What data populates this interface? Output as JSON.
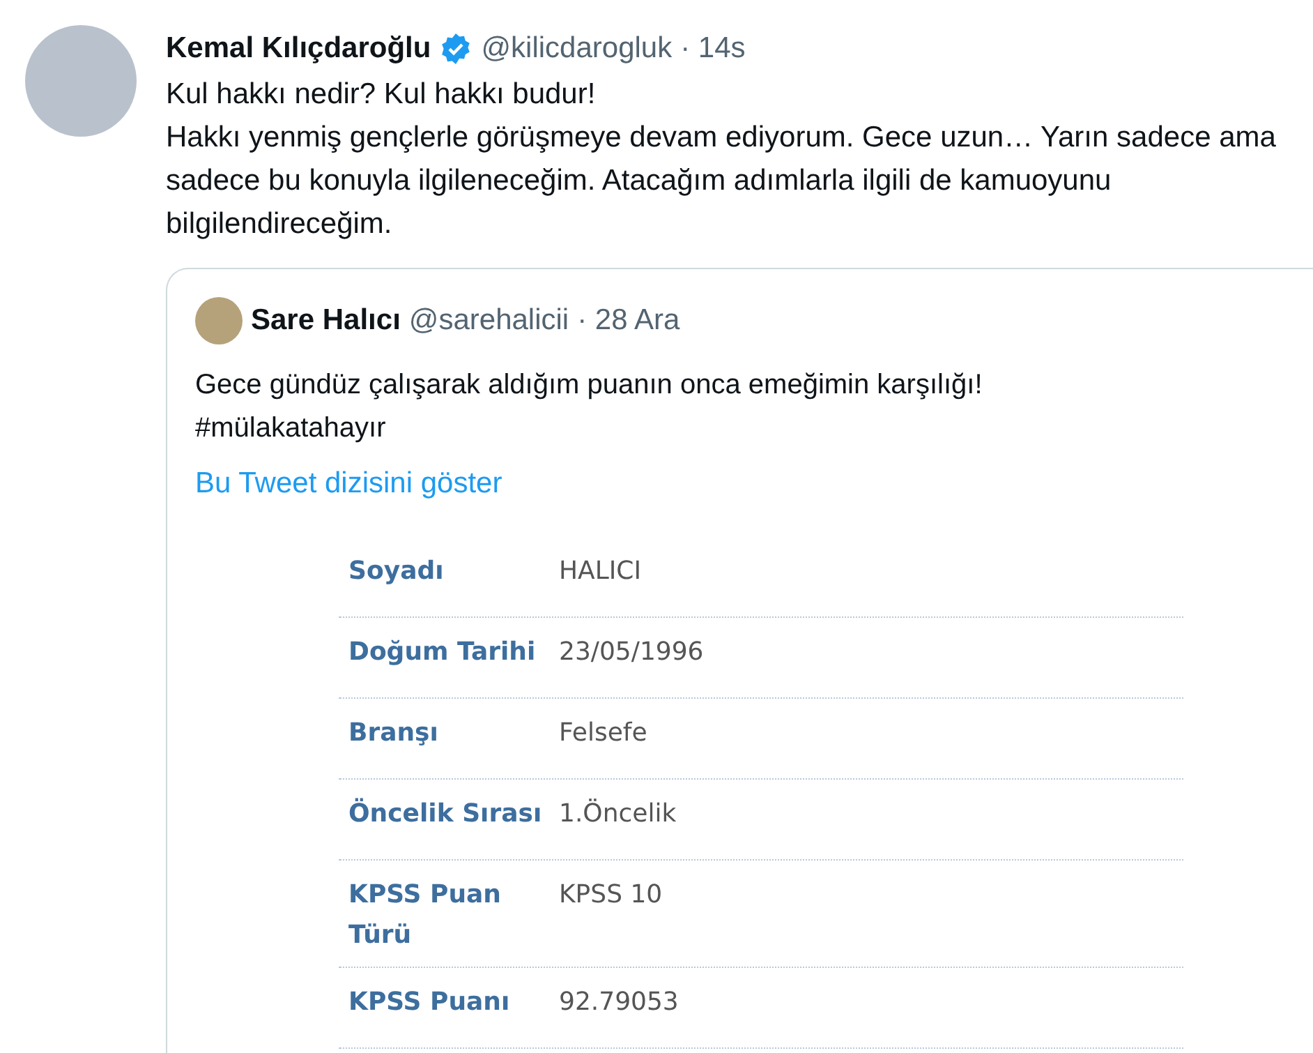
{
  "tweet": {
    "author": {
      "name": "Kemal Kılıçdaroğlu",
      "verified": true,
      "handle": "@kilicdarogluk",
      "time": "· 14s"
    },
    "paragraphs": [
      "Kul hakkı nedir? Kul hakkı budur!",
      "Hakkı yenmiş gençlerle görüşmeye devam ediyorum. Gece uzun… Yarın sadece ama sadece bu konuyla ilgileneceğim. Atacağım adımlarla ilgili de kamuoyunu bilgilendireceğim."
    ],
    "quoted": {
      "author": {
        "name": "Sare Halıcı",
        "handle": "@sarehalicii",
        "time": "· 28 Ara"
      },
      "paragraphs": [
        "Gece gündüz çalışarak aldığım puanın onca emeğimin karşılığı!",
        "#mülakatahayır"
      ],
      "thread_link": "Bu Tweet dizisini göster",
      "document": {
        "rows": [
          {
            "label": "Soyadı",
            "value": "HALICI"
          },
          {
            "label": "Doğum Tarihi",
            "value": "23/05/1996"
          },
          {
            "label": "Branşı",
            "value": "Felsefe"
          },
          {
            "label": "Öncelik Sırası",
            "value": "1.Öncelik"
          },
          {
            "label": "KPSS Puan Türü",
            "value": "KPSS 10"
          },
          {
            "label": "KPSS Puanı",
            "value": "92.79053"
          }
        ]
      }
    }
  }
}
